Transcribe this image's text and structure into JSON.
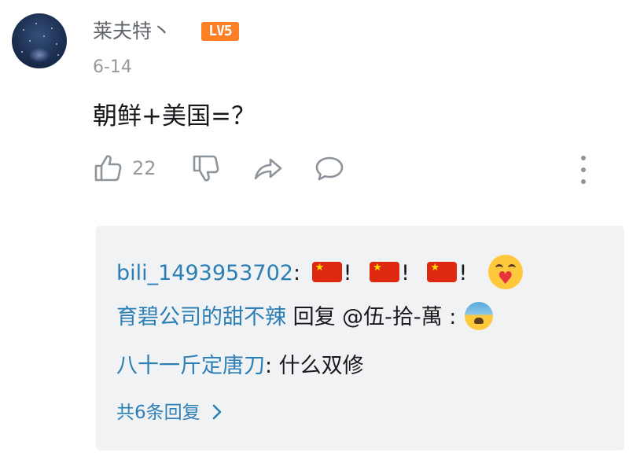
{
  "comment": {
    "username": "莱夫特丶",
    "level_badge": "LV5",
    "date": "6-14",
    "text": "朝鲜+美国=？",
    "like_count": "22"
  },
  "replies": [
    {
      "username": "bili_1493953702",
      "separator": ":",
      "flags": [
        "!",
        "!",
        "!"
      ],
      "emoji": "heart-hug-emoji"
    },
    {
      "username": "育碧公司的甜不辣",
      "text": " 回复 @伍-拾-萬 :",
      "emoji": "fearful-sweat-emoji"
    },
    {
      "username": "八十一斤定唐刀",
      "text": ": 什么双修"
    }
  ],
  "more_replies_label": "共6条回复",
  "colors": {
    "level_badge": "#ff7f24",
    "reply_username": "#2b7fb5",
    "reply_box_bg": "#f1f2f3",
    "muted_text": "#9499a0"
  },
  "icons": [
    "thumbs-up-icon",
    "thumbs-down-icon",
    "share-icon",
    "comment-icon",
    "more-vertical-icon",
    "chevron-right-icon"
  ]
}
